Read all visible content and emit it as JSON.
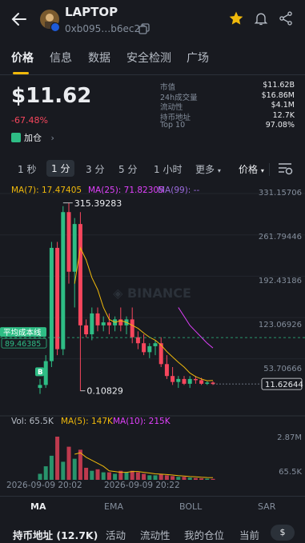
{
  "header": {
    "token_name": "LAPTOP",
    "token_address": "0xb095…b6ec29"
  },
  "tabs": [
    "价格",
    "信息",
    "数据",
    "安全检测",
    "广场"
  ],
  "price": {
    "value": "$11.62",
    "change": "-67.48%",
    "add_position": "加仓"
  },
  "stats": [
    {
      "k": "市值",
      "v": "$11.62B"
    },
    {
      "k": "24h成交量",
      "v": "$16.86M"
    },
    {
      "k": "流动性",
      "v": "$4.1M"
    },
    {
      "k": "持币地址",
      "v": "12.7K"
    },
    {
      "k": "Top 10",
      "v": "97.08%"
    }
  ],
  "intervals": [
    "1 秒",
    "1 分",
    "3 分",
    "5 分",
    "1 小时",
    "更多",
    "价格"
  ],
  "chart_data": {
    "type": "candlestick",
    "ma_legend": [
      "MA(7): 17.47405",
      "MA(25): 71.82305",
      "MA(99): --"
    ],
    "yaxis": [
      "331.15706",
      "261.79446",
      "192.43186",
      "123.06926",
      "53.70666"
    ],
    "high_label": "315.39283",
    "low_label": "0.10829",
    "last_price": "11.62644",
    "avg_cost_label": "平均成本线",
    "avg_cost_value": "89.46385",
    "watermark": "BINANCE",
    "vol_legend": [
      "Vol: 65.5K",
      "MA(5): 147K",
      "MA(10): 215K"
    ],
    "vol_axis": [
      "2.87M",
      "65.5K"
    ],
    "xaxis": [
      "2026-09-09 20:02",
      "2026-09-09 20:22"
    ],
    "colors": {
      "up": "#2ebd85",
      "down": "#f6465d",
      "ma7": "#f0b90b",
      "ma25": "#e040fb",
      "ma99": "#9c6ade"
    },
    "candles": [
      {
        "o": 5,
        "h": 20,
        "l": -5,
        "c": 10
      },
      {
        "o": 10,
        "h": 60,
        "l": 5,
        "c": 50
      },
      {
        "o": 50,
        "h": 250,
        "l": 40,
        "c": 240
      },
      {
        "o": 240,
        "h": 250,
        "l": 60,
        "c": 70
      },
      {
        "o": 70,
        "h": 310,
        "l": 60,
        "c": 300
      },
      {
        "o": 300,
        "h": 315,
        "l": 180,
        "c": 200
      },
      {
        "o": 200,
        "h": 290,
        "l": 140,
        "c": 280
      },
      {
        "o": 280,
        "h": 300,
        "l": 0.1,
        "c": 110
      },
      {
        "o": 110,
        "h": 120,
        "l": 90,
        "c": 95
      },
      {
        "o": 95,
        "h": 140,
        "l": 85,
        "c": 130
      },
      {
        "o": 130,
        "h": 140,
        "l": 100,
        "c": 110
      },
      {
        "o": 110,
        "h": 125,
        "l": 100,
        "c": 115
      },
      {
        "o": 115,
        "h": 130,
        "l": 95,
        "c": 110
      },
      {
        "o": 110,
        "h": 125,
        "l": 100,
        "c": 120
      },
      {
        "o": 120,
        "h": 140,
        "l": 100,
        "c": 110
      },
      {
        "o": 110,
        "h": 125,
        "l": 95,
        "c": 120
      },
      {
        "o": 120,
        "h": 140,
        "l": 80,
        "c": 90
      },
      {
        "o": 90,
        "h": 100,
        "l": 70,
        "c": 80
      },
      {
        "o": 80,
        "h": 95,
        "l": 60,
        "c": 65
      },
      {
        "o": 65,
        "h": 80,
        "l": 55,
        "c": 75
      },
      {
        "o": 75,
        "h": 85,
        "l": 60,
        "c": 80
      },
      {
        "o": 80,
        "h": 90,
        "l": 40,
        "c": 45
      },
      {
        "o": 45,
        "h": 60,
        "l": 20,
        "c": 25
      },
      {
        "o": 25,
        "h": 40,
        "l": 10,
        "c": 15
      },
      {
        "o": 15,
        "h": 25,
        "l": 5,
        "c": 20
      },
      {
        "o": 20,
        "h": 25,
        "l": 10,
        "c": 12
      },
      {
        "o": 12,
        "h": 25,
        "l": 5,
        "c": 20
      },
      {
        "o": 20,
        "h": 25,
        "l": 12,
        "c": 18
      },
      {
        "o": 18,
        "h": 22,
        "l": 10,
        "c": 12
      },
      {
        "o": 12,
        "h": 16,
        "l": 10,
        "c": 14
      },
      {
        "o": 14,
        "h": 16,
        "l": 10,
        "c": 11.6
      }
    ],
    "ma7": [
      null,
      null,
      null,
      null,
      null,
      null,
      180,
      240,
      220,
      190,
      170,
      140,
      120,
      115,
      118,
      115,
      110,
      105,
      97,
      90,
      85,
      77,
      66,
      57,
      48,
      40,
      30,
      24,
      20,
      17,
      17.5
    ],
    "ma25": [
      null,
      null,
      null,
      null,
      null,
      null,
      null,
      null,
      null,
      null,
      null,
      null,
      null,
      null,
      null,
      null,
      null,
      null,
      null,
      null,
      null,
      null,
      null,
      null,
      140,
      125,
      110,
      100,
      90,
      80,
      72
    ],
    "volumes": [
      0.4,
      0.9,
      1.6,
      2.87,
      1.2,
      2.2,
      1.4,
      2.0,
      0.8,
      0.6,
      0.7,
      0.5,
      0.5,
      0.4,
      0.6,
      0.5,
      0.6,
      0.5,
      0.4,
      0.3,
      0.3,
      0.4,
      0.3,
      0.25,
      0.2,
      0.2,
      0.15,
      0.12,
      0.1,
      0.08,
      0.065
    ],
    "vol_ma5": [
      null,
      null,
      null,
      null,
      null,
      null,
      1.7,
      1.8,
      1.5,
      1.3,
      1.1,
      0.9,
      0.6,
      0.55,
      0.5,
      0.5,
      0.55,
      0.55,
      0.5,
      0.45,
      0.4,
      0.38,
      0.35,
      0.32,
      0.28,
      0.25,
      0.22,
      0.2,
      0.17,
      0.15,
      0.147
    ]
  },
  "indicators": [
    "MA",
    "EMA",
    "BOLL",
    "SAR"
  ],
  "bottom_tabs": [
    "持币地址 (12.7K)",
    "活动",
    "流动性",
    "我的仓位",
    "当前"
  ],
  "currency": "$"
}
